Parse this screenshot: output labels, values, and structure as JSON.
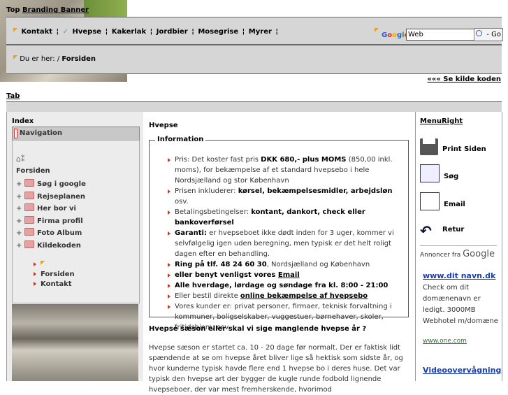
{
  "header": {
    "top_title_prefix": "Top ",
    "top_title_link": "Branding Banner",
    "menu": [
      "Kontakt",
      "Hvepse",
      "Kakerlak",
      "Jordbier",
      "Mosegrise",
      "Myrer"
    ],
    "menu_separator": "¦",
    "search": {
      "placeholder": "Web",
      "value": "Web",
      "go_label": "- Go",
      "google_label": "Google"
    },
    "breadcrumb_prefix": "Du er her: / ",
    "breadcrumb_current": "Forsiden",
    "kilde_link": "««« Se kilde koden"
  },
  "tab": {
    "label": "Tab"
  },
  "left": {
    "index_label": "Index",
    "nav_header": "Navigation",
    "tree_root": "Forsiden",
    "tree_items": [
      "Søg i google",
      "Rejseplanen",
      "Her bor vi",
      "Firma profil",
      "Foto Album",
      "Kildekoden"
    ],
    "sub_items": [
      "Forsiden",
      "Kontakt"
    ]
  },
  "center": {
    "title": "Hvepse",
    "info_legend": "Information",
    "info_items": [
      {
        "pre": "Pris: Det koster fast pris ",
        "bold": "DKK 680,- plus MOMS",
        "post": " (850,00 inkl. moms), for bekæmpelse af et standard hvepsebo i hele Nordsjælland og stor København"
      },
      {
        "pre": "Prisen inkluderer: ",
        "bold": "kørsel, bekæmpelsesmidler, arbejdsløn",
        "post": " osv."
      },
      {
        "pre": "Betalingsbetingelser: ",
        "bold": "kontant, dankort, check eller bankoverførsel",
        "post": ""
      },
      {
        "pre": "",
        "bold": "Garanti:",
        "post": " er hvepseboet ikke dødt inden for 3 uger, kommer vi selvfølgelig igen uden beregning, men typisk er det helt roligt dagen efter en behandling."
      },
      {
        "pre": "",
        "bold": "Ring på tlf. 48 24 60 30",
        "post": ", Nordsjælland og København"
      },
      {
        "pre": "",
        "bold": "eller benyt venligst vores ",
        "link": "Email",
        "post": ""
      },
      {
        "pre": "",
        "bold": "Alle hverdage, lørdage og søndage fra kl. 8:00 - 21:00",
        "post": ""
      },
      {
        "pre": "Eller bestil direkte ",
        "link": "online bekæmpelse af hvepsebo",
        "post": ""
      },
      {
        "pre": "Vores kunder er: privat personer, firmaer, teknisk forvaltning i kommuner, boligselskaber, vuggestuer, børnehaver, skoler, fritidshjem, osv.",
        "bold": "",
        "post": ""
      }
    ],
    "season_heading": "Hvepse sæson eller skal vi sige manglende hvepse år ?",
    "season_text": "Hvepse sæson er startet ca. 10 - 20 dage før normalt. Der er faktisk lidt spændende at se om hvepse året bliver lige så hektisk som sidste år, og hvor kunderne typisk havde flere end 1 hvepse bo i deres huse. Det var typisk den hvepse art der bygger de kugle runde fodbold lignende hvepseboer, der var mest fremherskende, hvorimod"
  },
  "right": {
    "title": "MenuRight",
    "items": [
      "Print Siden",
      "Søg",
      "Email",
      "Retur"
    ],
    "ads_by_prefix": "Annoncer fra",
    "ads_by_google": "Google",
    "ad1_title": "www.dit navn.dk",
    "ad1_text": "Check om dit domænenavn er ledigt. 3000MB Webhotel m/domæne",
    "ad1_url": "www.one.com",
    "ad2_title": "Videoovervågning"
  },
  "colors": {
    "bar_gray": "#d6d6d6",
    "panel_gray": "#ececec",
    "ad_link": "#1a3fb3",
    "bullet": "#c0392b"
  }
}
